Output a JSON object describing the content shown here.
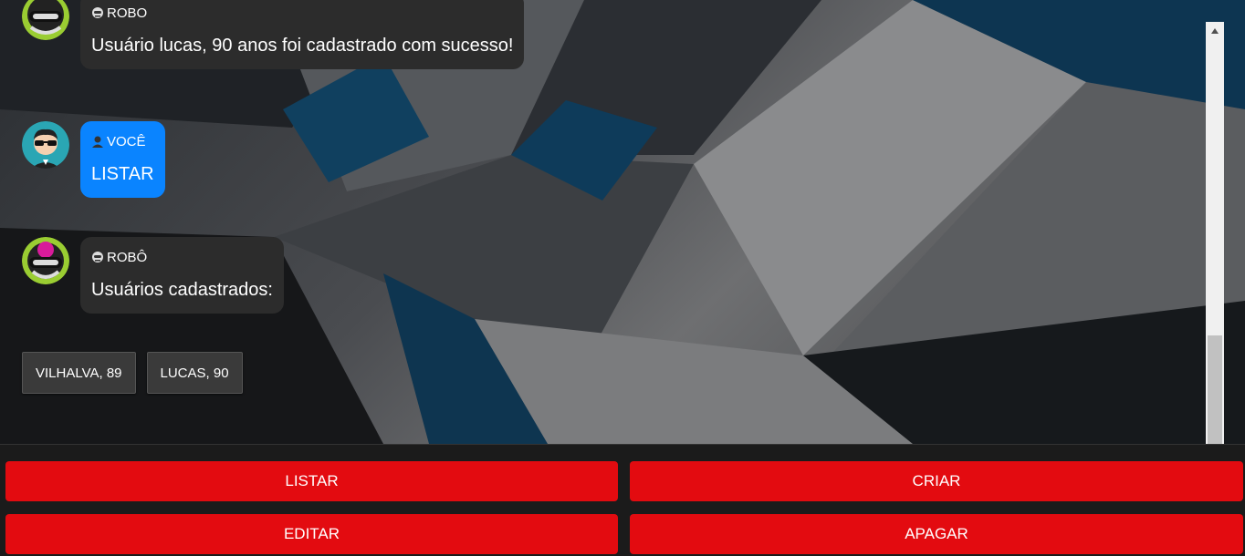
{
  "messages": [
    {
      "sender": "ROBO",
      "text": "Usuário lucas, 90 anos foi cadastrado com sucesso!",
      "from": "bot"
    },
    {
      "sender": "VOCÊ",
      "text": "LISTAR",
      "from": "user"
    },
    {
      "sender": "ROBÔ",
      "text": "Usuários cadastrados:",
      "from": "bot"
    }
  ],
  "chips": [
    "VILHALVA, 89",
    "LUCAS, 90"
  ],
  "actions": {
    "listar": "LISTAR",
    "criar": "CRIAR",
    "editar": "EDITAR",
    "apagar": "APAGAR"
  },
  "colors": {
    "bot_bubble": "#2c2c2c",
    "user_bubble": "#0a84ff",
    "action_button": "#e30b10",
    "panel": "#1b1b1b"
  },
  "icons": {
    "bot_avatar": "robot-avatar-icon",
    "user_avatar": "user-sunglasses-avatar-icon",
    "bot_label": "robot-icon",
    "user_label": "user-icon",
    "scroll_up": "triangle-up-icon"
  }
}
